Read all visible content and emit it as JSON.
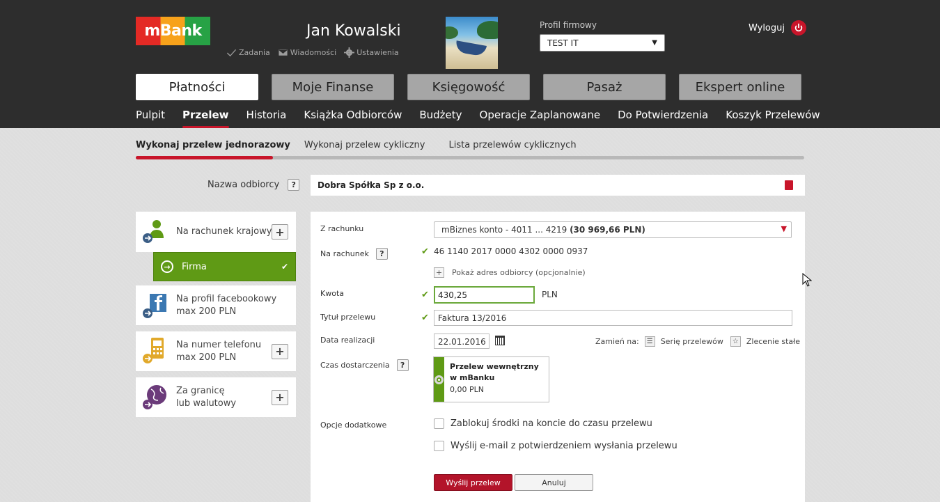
{
  "header": {
    "logo_text": "mBank",
    "user_name": "Jan Kowalski",
    "shortcuts": [
      "Zadania",
      "Wiadomości",
      "Ustawienia"
    ],
    "profile_label": "Profil firmowy",
    "profile_value": "TEST IT",
    "logout": "Wyloguj"
  },
  "main_tabs": [
    "Płatności",
    "Moje Finanse",
    "Księgowość",
    "Pasaż",
    "Ekspert online"
  ],
  "subnav": [
    "Pulpit",
    "Przelew",
    "Historia",
    "Książka Odbiorców",
    "Budżety",
    "Operacje Zaplanowane",
    "Do Potwierdzenia",
    "Koszyk Przelewów"
  ],
  "transfer_tabs": [
    "Wykonaj przelew jednorazowy",
    "Wykonaj przelew cykliczny",
    "Lista przelewów cyklicznych"
  ],
  "recipient": {
    "label": "Nazwa odbiorcy",
    "help": "?",
    "value": "Dobra Spółka Sp z o.o."
  },
  "left_menu": {
    "domestic": {
      "line1": "Na rachunek krajowy",
      "plus": "+"
    },
    "firm": {
      "label": "Firma",
      "tick": "✔"
    },
    "facebook": {
      "line1": "Na profil facebookowy",
      "line2": "max 200 PLN"
    },
    "phone": {
      "line1": "Na numer telefonu",
      "line2": "max 200 PLN",
      "plus": "+"
    },
    "abroad": {
      "line1": "Za granicę",
      "line2": "lub walutowy",
      "plus": "+"
    }
  },
  "form": {
    "from_label": "Z rachunku",
    "from_value": "mBiznes konto - 4011 ... 4219",
    "from_balance": "(30 969,66 PLN)",
    "to_label": "Na rachunek",
    "to_value": "46 1140 2017 0000 4302 0000 0937",
    "show_address": "Pokaż adres odbiorcy (opcjonalnie)",
    "amount_label": "Kwota",
    "amount_value": "430,25",
    "currency": "PLN",
    "title_label": "Tytuł przelewu",
    "title_value": "Faktura 13/2016",
    "date_label": "Data realizacji",
    "date_value": "22.01.2016",
    "swap_label": "Zamień na:",
    "swap_series": "Serię przelewów",
    "swap_standing": "Zlecenie stałe",
    "delivery_label": "Czas dostarczenia",
    "delivery_title": "Przelew wewnętrzny w mBanku",
    "delivery_cost": "0,00 PLN",
    "options_label": "Opcje dodatkowe",
    "option_block": "Zablokuj środki na koncie do czasu przelewu",
    "option_email": "Wyślij e-mail z potwierdzeniem wysłania przelewu",
    "send": "Wyślij przelew",
    "cancel": "Anuluj"
  },
  "colors": {
    "brand_red": "#c8152a",
    "green": "#5f9a15",
    "header_bg": "#2d2d2d"
  }
}
